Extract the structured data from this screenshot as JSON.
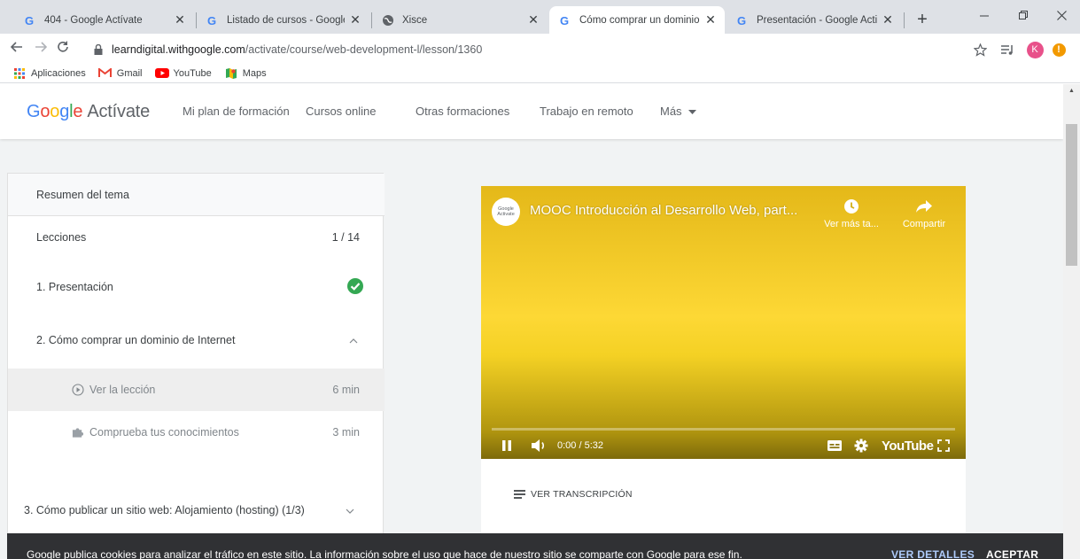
{
  "browser": {
    "tabs": [
      {
        "label": "404 - Google Actívate",
        "active": false
      },
      {
        "label": "Listado de cursos - Google Acti",
        "active": false
      },
      {
        "label": "Xisce",
        "active": false
      },
      {
        "label": "Cómo comprar un dominio de",
        "active": true
      },
      {
        "label": "Presentación - Google Activate",
        "active": false
      }
    ],
    "new_tab": "+",
    "url_host": "learndigital.withgoogle.com",
    "url_path": "/activate/course/web-development-l/lesson/1360",
    "profile_initial": "K",
    "bookmarks": [
      "Aplicaciones",
      "Gmail",
      "YouTube",
      "Maps"
    ]
  },
  "header": {
    "logo_letters": [
      "G",
      "o",
      "o",
      "g",
      "l",
      "e"
    ],
    "logo_suffix": "Actívate",
    "nav": [
      "Mi plan de formación",
      "Cursos online",
      "Otras formaciones",
      "Trabajo en remoto",
      "Más"
    ]
  },
  "sidebar": {
    "summary": "Resumen del tema",
    "lessons_label": "Lecciones",
    "lessons_count": "1 / 14",
    "items": [
      {
        "label": "1. Presentación"
      },
      {
        "label": "2. Cómo comprar un dominio de Internet"
      },
      {
        "label": "Ver la lección",
        "duration": "6 min"
      },
      {
        "label": "Comprueba tus conocimientos",
        "duration": "3 min"
      },
      {
        "label": "3. Cómo publicar un sitio web: Alojamiento (hosting) (1/3)"
      }
    ]
  },
  "video": {
    "avatar_text": "Google Activate",
    "title": "MOOC Introducción al Desarrollo Web, part...",
    "watch_later": "Ver más ta...",
    "share": "Compartir",
    "time": "0:00 / 5:32",
    "youtube": "YouTube",
    "progress": 0
  },
  "transcript_label": "VER TRANSCRIPCIÓN",
  "cookie": {
    "text": "Google publica cookies para analizar el tráfico en este sitio. La información sobre el uso que hace de nuestro sitio se comparte con Google para ese fin.",
    "details": "VER DETALLES",
    "accept": "ACEPTAR"
  },
  "colors": {
    "accent": "#1a73e8",
    "check": "#34a853",
    "video_yellow": "#fdd835"
  }
}
